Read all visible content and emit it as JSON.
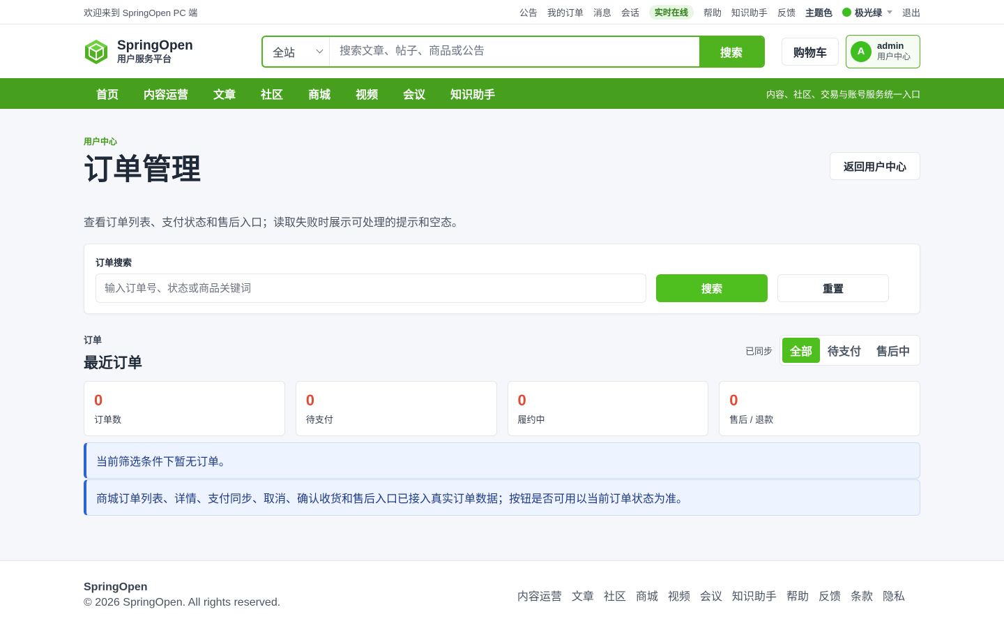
{
  "topbar": {
    "welcome": "欢迎来到 SpringOpen PC 端",
    "links": [
      "公告",
      "我的订单",
      "消息",
      "会话"
    ],
    "online": "实时在线",
    "links2": [
      "帮助",
      "知识助手",
      "反馈"
    ],
    "theme_label": "主题色",
    "theme_value": "极光绿",
    "logout": "退出"
  },
  "header": {
    "logo_name": "SpringOpen",
    "logo_sub": "用户服务平台",
    "search_scope": "全站",
    "search_placeholder": "搜索文章、帖子、商品或公告",
    "search_button": "搜索",
    "cart": "购物车",
    "avatar_letter": "A",
    "user_name": "admin",
    "user_sub": "用户中心"
  },
  "nav": {
    "items": [
      "首页",
      "内容运营",
      "文章",
      "社区",
      "商城",
      "视频",
      "会议",
      "知识助手"
    ],
    "tagline": "内容、社区、交易与账号服务统一入口"
  },
  "page": {
    "crumb": "用户中心",
    "title": "订单管理",
    "back_button": "返回用户中心",
    "description": "查看订单列表、支付状态和售后入口；读取失败时展示可处理的提示和空态。"
  },
  "order_search": {
    "label": "订单搜索",
    "placeholder": "输入订单号、状态或商品关键词",
    "search_button": "搜索",
    "reset_button": "重置"
  },
  "orders": {
    "kicker": "订单",
    "title": "最近订单",
    "sync_status": "已同步",
    "filters": [
      "全部",
      "待支付",
      "售后中"
    ],
    "active_filter": "全部",
    "stats": [
      {
        "value": "0",
        "label": "订单数"
      },
      {
        "value": "0",
        "label": "待支付"
      },
      {
        "value": "0",
        "label": "履约中"
      },
      {
        "value": "0",
        "label": "售后 / 退款"
      }
    ],
    "notices": [
      "当前筛选条件下暂无订单。",
      "商城订单列表、详情、支付同步、取消、确认收货和售后入口已接入真实订单数据；按钮是否可用以当前订单状态为准。"
    ]
  },
  "footer": {
    "brand": "SpringOpen",
    "copyright": "© 2026 SpringOpen. All rights reserved.",
    "links": [
      "内容运营",
      "文章",
      "社区",
      "商城",
      "视频",
      "会议",
      "知识助手",
      "帮助",
      "反馈",
      "条款",
      "隐私"
    ]
  },
  "colors": {
    "brand_green": "#46a01d",
    "accent_green": "#4fbf1f",
    "stat_red": "#e04b34",
    "notice_blue": "#2c64d4"
  }
}
